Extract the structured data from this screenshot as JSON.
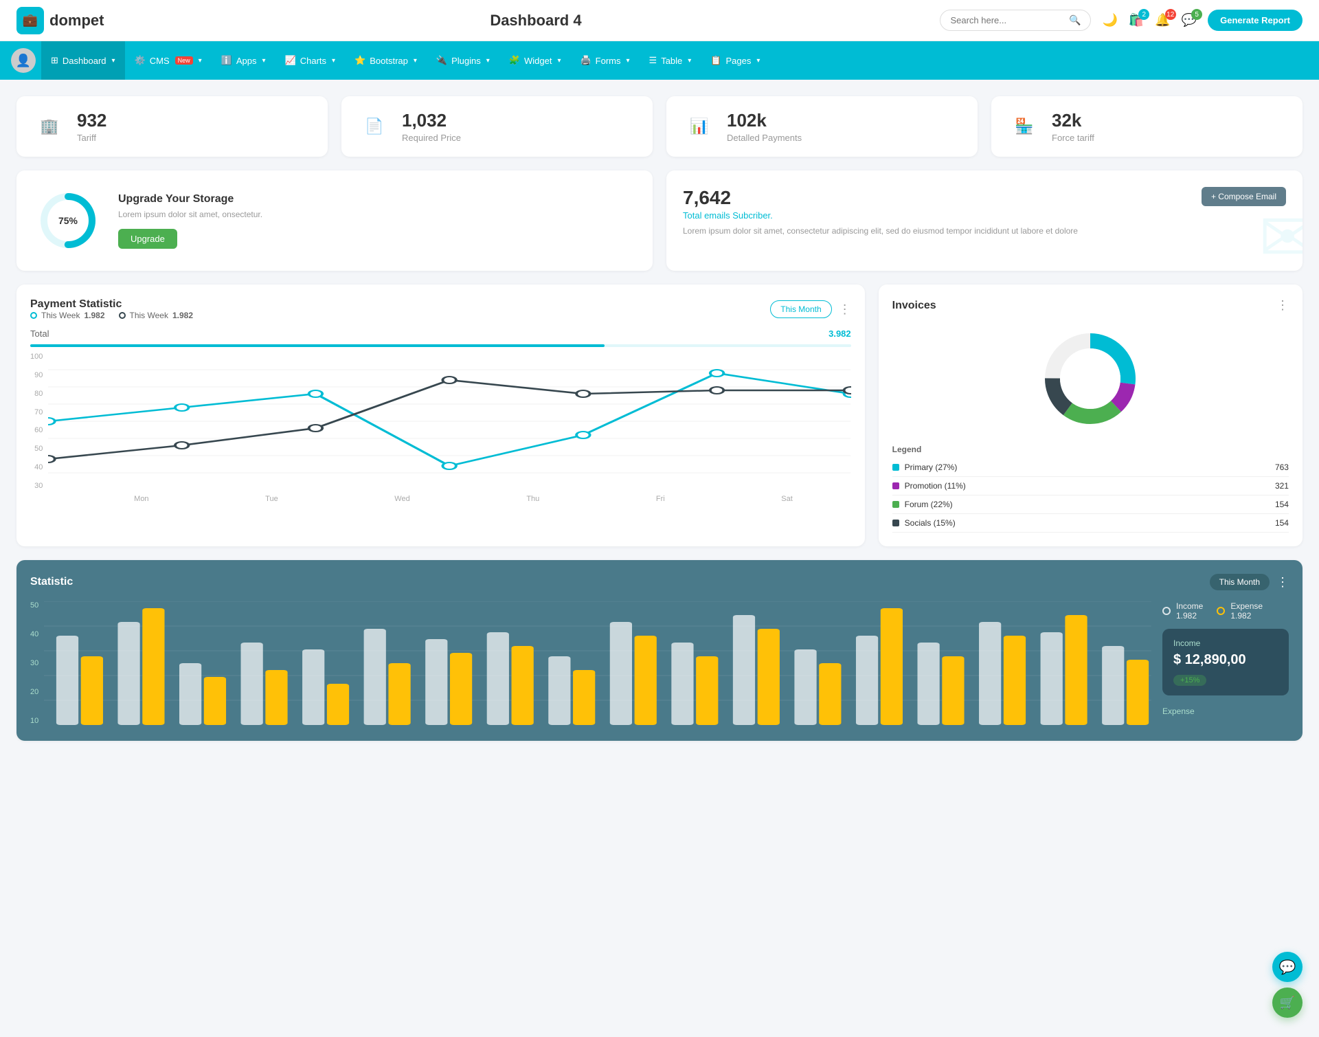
{
  "header": {
    "logo_icon": "💼",
    "logo_name": "dompet",
    "page_title": "Dashboard 4",
    "search_placeholder": "Search here...",
    "icons": {
      "moon": "🌙",
      "shop": "🛍️",
      "bell": "🔔",
      "chat": "💬"
    },
    "badges": {
      "shop": "2",
      "bell": "12",
      "chat": "5"
    },
    "generate_btn": "Generate Report"
  },
  "navbar": {
    "avatar": "👤",
    "items": [
      {
        "label": "Dashboard",
        "active": true,
        "has_arrow": true
      },
      {
        "label": "CMS",
        "active": false,
        "has_arrow": true,
        "badge": "New"
      },
      {
        "label": "Apps",
        "active": false,
        "has_arrow": true
      },
      {
        "label": "Charts",
        "active": false,
        "has_arrow": true
      },
      {
        "label": "Bootstrap",
        "active": false,
        "has_arrow": true
      },
      {
        "label": "Plugins",
        "active": false,
        "has_arrow": true
      },
      {
        "label": "Widget",
        "active": false,
        "has_arrow": true
      },
      {
        "label": "Forms",
        "active": false,
        "has_arrow": true
      },
      {
        "label": "Table",
        "active": false,
        "has_arrow": true
      },
      {
        "label": "Pages",
        "active": false,
        "has_arrow": true
      }
    ]
  },
  "stat_cards": [
    {
      "value": "932",
      "label": "Tariff",
      "icon": "🏢",
      "icon_class": "teal"
    },
    {
      "value": "1,032",
      "label": "Required Price",
      "icon": "📄",
      "icon_class": "red"
    },
    {
      "value": "102k",
      "label": "Detalled Payments",
      "icon": "📊",
      "icon_class": "purple"
    },
    {
      "value": "32k",
      "label": "Force tariff",
      "icon": "🏪",
      "icon_class": "pink"
    }
  ],
  "storage": {
    "percent": "75%",
    "title": "Upgrade Your Storage",
    "desc": "Lorem ipsum dolor sit amet, onsectetur.",
    "btn_label": "Upgrade"
  },
  "email": {
    "count": "7,642",
    "subtitle": "Total emails Subcriber.",
    "desc": "Lorem ipsum dolor sit amet, consectetur adipiscing elit, sed do eiusmod tempor incididunt ut labore et dolore",
    "compose_btn": "+ Compose Email"
  },
  "payment_statistic": {
    "title": "Payment Statistic",
    "legend": [
      {
        "label": "This Week",
        "value": "1.982",
        "color": "teal"
      },
      {
        "label": "This Week",
        "value": "1.982",
        "color": "dark"
      }
    ],
    "month_btn": "This Month",
    "total_label": "Total",
    "total_value": "3.982",
    "x_axis": [
      "Mon",
      "Tue",
      "Wed",
      "Thu",
      "Fri",
      "Sat"
    ],
    "y_axis": [
      "100",
      "90",
      "80",
      "70",
      "60",
      "50",
      "40",
      "30"
    ]
  },
  "invoices": {
    "title": "Invoices",
    "legend": [
      {
        "label": "Primary (27%)",
        "value": "763",
        "color": "#00bcd4"
      },
      {
        "label": "Promotion (11%)",
        "value": "321",
        "color": "#9c27b0"
      },
      {
        "label": "Forum (22%)",
        "value": "154",
        "color": "#4caf50"
      },
      {
        "label": "Socials (15%)",
        "value": "154",
        "color": "#37474f"
      }
    ]
  },
  "statistic": {
    "title": "Statistic",
    "month_btn": "This Month",
    "legend": [
      {
        "label": "Income",
        "value": "1.982",
        "color": "white"
      },
      {
        "label": "Expense",
        "value": "1.982",
        "color": "yellow"
      }
    ],
    "income_popup": {
      "title": "Income",
      "value": "$ 12,890,00",
      "badge": "+15%"
    },
    "expense_label": "Expense",
    "y_axis": [
      "50",
      "40",
      "30",
      "20",
      "10"
    ]
  }
}
